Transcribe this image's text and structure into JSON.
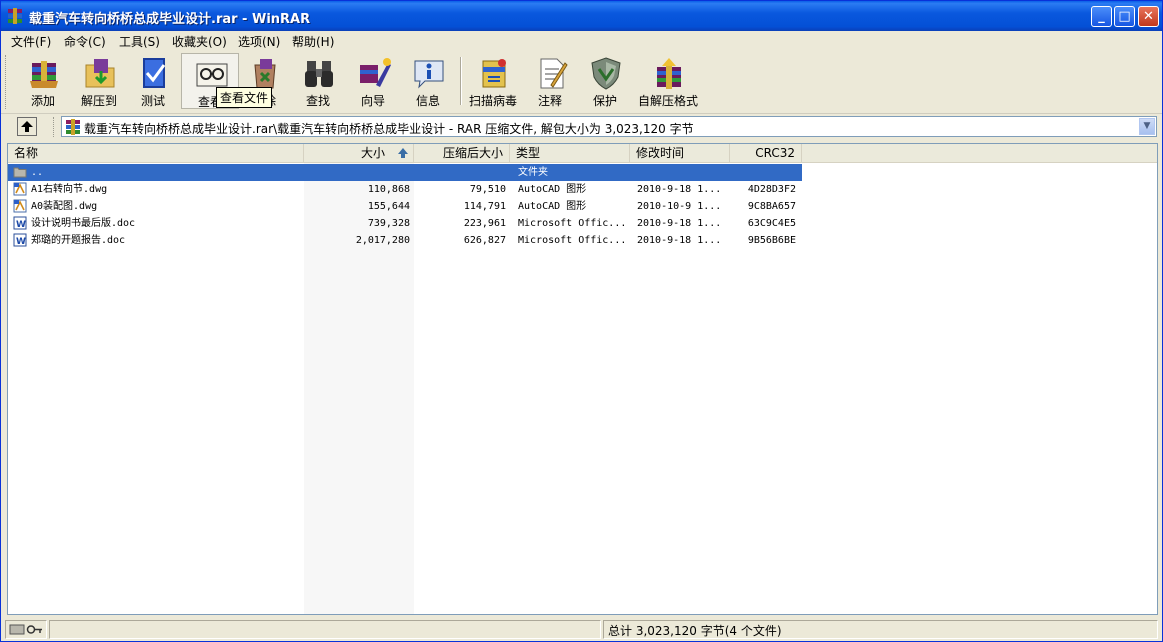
{
  "window": {
    "title": "载重汽车转向桥桥总成毕业设计.rar - WinRAR"
  },
  "title_buttons": {
    "minimize": "_",
    "maximize": "□",
    "close": "✕"
  },
  "menu": [
    "文件(F)",
    "命令(C)",
    "工具(S)",
    "收藏夹(O)",
    "选项(N)",
    "帮助(H)"
  ],
  "toolbar": {
    "buttons": [
      {
        "label": "添加",
        "icon": "add-archive-icon"
      },
      {
        "label": "解压到",
        "icon": "extract-to-icon"
      },
      {
        "label": "测试",
        "icon": "test-icon"
      },
      {
        "label": "查看",
        "icon": "view-icon"
      },
      {
        "label": "删除",
        "icon": "delete-icon"
      },
      {
        "label": "查找",
        "icon": "find-binoculars-icon"
      },
      {
        "label": "向导",
        "icon": "wizard-icon"
      },
      {
        "label": "信息",
        "icon": "info-icon"
      },
      {
        "label": "扫描病毒",
        "icon": "virus-scan-icon"
      },
      {
        "label": "注释",
        "icon": "comment-icon"
      },
      {
        "label": "保护",
        "icon": "protect-shield-icon"
      },
      {
        "label": "自解压格式",
        "icon": "sfx-icon"
      }
    ],
    "tooltip": "查看文件"
  },
  "address": {
    "path": "载重汽车转向桥桥总成毕业设计.rar\\载重汽车转向桥桥总成毕业设计 - RAR 压缩文件, 解包大小为 3,023,120 字节"
  },
  "columns": {
    "name": "名称",
    "size": "大小",
    "packed": "压缩后大小",
    "type": "类型",
    "modified": "修改时间",
    "crc": "CRC32"
  },
  "files": [
    {
      "name": "..",
      "size": "",
      "packed": "",
      "type": "文件夹",
      "modified": "",
      "crc": "",
      "icon": "folder-icon",
      "selected": true
    },
    {
      "name": "A1右转向节.dwg",
      "size": "110,868",
      "packed": "79,510",
      "type": "AutoCAD 图形",
      "modified": "2010-9-18 1...",
      "crc": "4D28D3F2",
      "icon": "dwg-file-icon",
      "selected": false
    },
    {
      "name": "A0装配图.dwg",
      "size": "155,644",
      "packed": "114,791",
      "type": "AutoCAD 图形",
      "modified": "2010-10-9 1...",
      "crc": "9C8BA657",
      "icon": "dwg-file-icon",
      "selected": false
    },
    {
      "name": "设计说明书最后版.doc",
      "size": "739,328",
      "packed": "223,961",
      "type": "Microsoft Offic...",
      "modified": "2010-9-18 1...",
      "crc": "63C9C4E5",
      "icon": "word-doc-icon",
      "selected": false
    },
    {
      "name": "郑璐的开题报告.doc",
      "size": "2,017,280",
      "packed": "626,827",
      "type": "Microsoft Offic...",
      "modified": "2010-9-18 1...",
      "crc": "9B56B6BE",
      "icon": "word-doc-icon",
      "selected": false
    }
  ],
  "status": {
    "total": "总计 3,023,120 字节(4 个文件)"
  }
}
